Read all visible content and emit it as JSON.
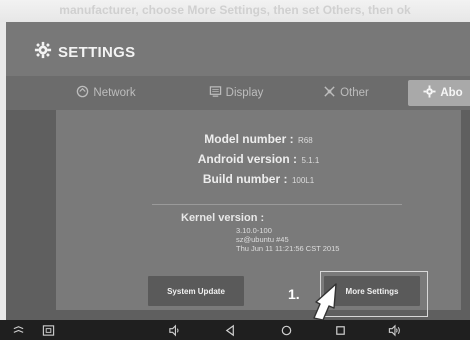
{
  "caption": "manufacturer, choose More Settings, then set Others, then ok",
  "header": {
    "title": "SETTINGS"
  },
  "tabs": [
    {
      "label": "Network",
      "icon": "network-icon",
      "active": false
    },
    {
      "label": "Display",
      "icon": "display-icon",
      "active": false
    },
    {
      "label": "Other",
      "icon": "other-icon",
      "active": false
    },
    {
      "label": "Abo",
      "icon": "about-icon",
      "active": true
    }
  ],
  "about": {
    "model_label": "Model number :",
    "model_value": "R68",
    "android_label": "Android version :",
    "android_value": "5.1.1",
    "build_label": "Build number :",
    "build_value": "100L1",
    "kernel_label": "Kernel version :",
    "kernel_lines": [
      "3.10.0-100",
      "sz@ubuntu #45",
      "Thu Jun 11 11:21:56 CST 2015"
    ]
  },
  "buttons": {
    "system_update": "System Update",
    "more_settings": "More Settings"
  },
  "annotation": {
    "step": "1."
  },
  "navbar": {
    "icons": [
      "expand-icon",
      "screenshot-icon",
      "volume-down-icon",
      "back-icon",
      "home-icon",
      "recents-icon",
      "volume-up-icon"
    ]
  },
  "colors": {
    "screen_bg": "#5f5f5f",
    "active_tab": "#a9a9a9",
    "navbar_bg": "#1f1f1f"
  }
}
